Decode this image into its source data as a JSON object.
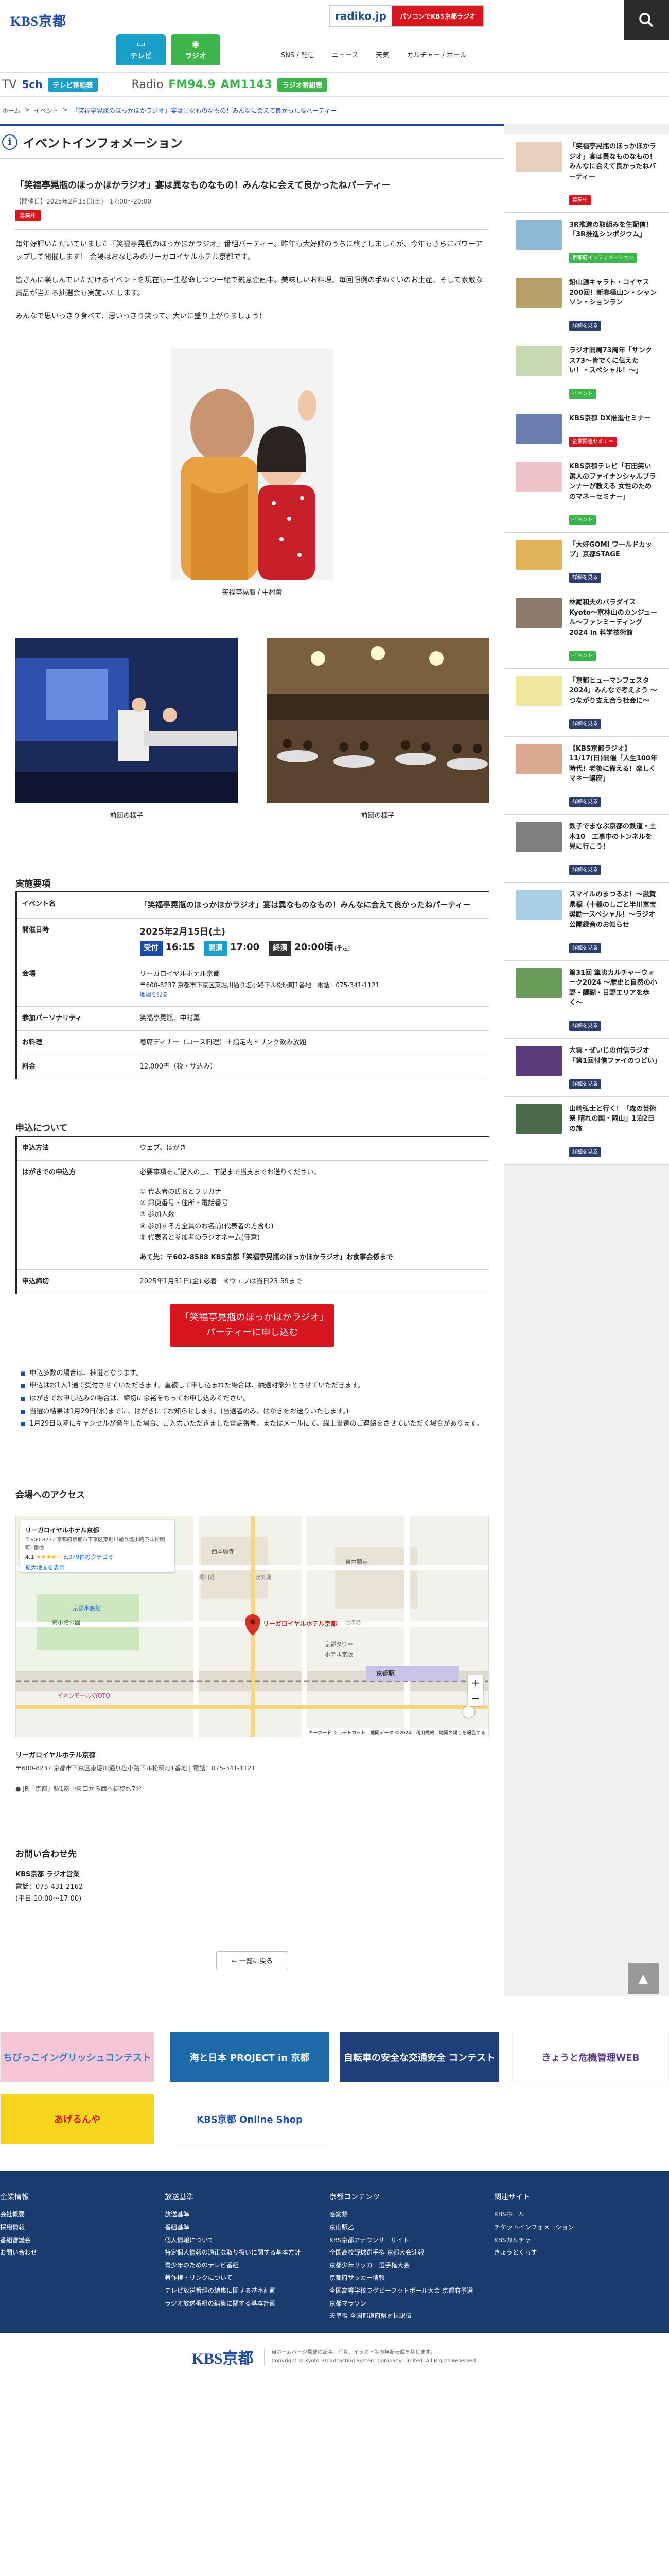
{
  "header": {
    "logo": "KBS京都",
    "tabs": [
      {
        "label": "テレビ",
        "icon": "tv-icon"
      },
      {
        "label": "ラジオ",
        "icon": "radio-icon"
      }
    ],
    "nav": [
      "SNS / 配信",
      "ニュース",
      "天気",
      "カルチャー / ホール"
    ],
    "radiko_logo": "radiko.jp",
    "radiko_text": "パソコンでKBS京都ラジオ"
  },
  "channels": {
    "tv_label": "TV",
    "tv_num": "5ch",
    "tv_pill": "テレビ番組表",
    "radio_label": "Radio",
    "fm": "FM94.9",
    "am": "AM1143",
    "radio_pill": "ラジオ番組表"
  },
  "breadcrumb": {
    "home": "ホーム",
    "events": "イベント",
    "current": "「笑福亭晃瓶のほっかほかラジオ」宴は異なものなもの！みんなに会えて良かったねパーティー"
  },
  "section_title": "イベントインフォメーション",
  "event": {
    "title": "「笑福亭晃瓶のほっかほかラジオ」宴は異なものなもの！みんなに会えて良かったねパーティー",
    "meta": "【開催日】2025年2月15日(土)　17:00〜20:00",
    "tag": "募集中",
    "para1": "毎年好評いただいていました「笑福亭晃瓶のほっかほかラジオ」番組パーティー。昨年も大好評のうちに終了しましたが、今年もさらにパワーアップして開催します！ 会場はおなじみのリーガロイヤルホテル京都です。",
    "para2": "皆さんに楽しんでいただけるイベントを現在も一生懸命しつつ一緒で鋭意企画中。美味しいお料理、毎回恒例の手ぬぐいのお土産、そして素敵な賞品が当たる抽選会も実施いたします。",
    "para3": "みんなで思いっきり食べて、思いっきり笑って、大いに盛り上がりましょう！",
    "photo_caption": "笑福亭晃瓶 / 中村薫",
    "prev1_caption": "前回の様子",
    "prev2_caption": "前回の様子"
  },
  "details": {
    "heading": "実施要項",
    "rows": [
      {
        "key": "イベント名",
        "value": "「笑福亭晃瓶のほっかほかラジオ」宴は異なものなもの！みんなに会えて良かったねパーティー"
      },
      {
        "key": "開催日時",
        "date": "2025年2月15日(土)",
        "open_label": "受付",
        "open_time": "16:15",
        "start_label": "開演",
        "start_time": "17:00",
        "end_label": "終演",
        "end_time": "20:00頃",
        "end_note": "(予定)"
      },
      {
        "key": "会場",
        "value": "リーガロイヤルホテル京都",
        "address": "〒600-8237 京都市下京区東堀川通り塩小路下ル松明町1番地 | 電話：075-341-1121",
        "map_link": "地図を見る"
      },
      {
        "key": "参加パーソナリティ",
        "value": "笑福亭晃瓶、中村薫"
      },
      {
        "key": "お料理",
        "value": "着席ディナー（コース料理）＋指定内ドリンク飲み放題"
      },
      {
        "key": "料金",
        "value": "12,000円（税・サ込み）"
      }
    ]
  },
  "apply": {
    "heading": "申込について",
    "rows": [
      {
        "key": "申込方法",
        "value": "ウェブ、はがき"
      },
      {
        "key": "はがきでの申込方",
        "intro": "必要事項をご記入の上、下記まで当支までお送りください。",
        "items": [
          "① 代表者の氏名とフリガナ",
          "② 郵便番号・住所・電話番号",
          "③ 参加人数",
          "④ 参加する方全員のお名前(代表者の方含む)",
          "⑤ 代表者と参加者のラジオネーム(任意)"
        ],
        "address": "あて先：〒602-8588 KBS京都「笑福亭晃瓶のほっかほかラジオ」お食事会係まで"
      },
      {
        "key": "申込締切",
        "value": "2025年1月31日(金) 必着　※ウェブは当日23:59まで"
      }
    ],
    "button": "「笑福亭晃瓶のほっかほかラジオ」パーティーに申し込む",
    "notes": [
      "申込多数の場合は、抽選となります。",
      "申込はお1人1通で受付させていただきます。重複して申し込まれた場合は、抽選対象外とさせていただきます。",
      "はがきでお申し込みの場合は、締切に余裕をもってお申し込みください。",
      "当選の結果は1月29日(水)までに、はがきにてお知らせします。(当選者のみ。はがきをお送りいたします。)",
      "1月29日以降にキャンセルが発生した場合、ご入力いただきました電話番号、またはメールにて、繰上当選のご連絡をさせていただく場合があります。"
    ]
  },
  "access": {
    "heading": "会場へのアクセス",
    "map_place": "リーガロイヤルホテル京都",
    "map_address": "〒600-8237 京都府京都市下京区東堀川通り塩小路下ル松明町1番地",
    "map_rating": "4.1",
    "map_reviews": "3,079件のクチコミ",
    "map_link": "拡大地図を表示",
    "map_footer": "キーボード ショートカット　地図データ ©2024　利用規約　地図の誤りを報告する",
    "map_labels": [
      "京都水族館",
      "西本願寺",
      "東本願寺",
      "京都駅",
      "梅小路公園",
      "リーガロイヤルホテル京都",
      "イオンモールKYOTO",
      "京都タワー",
      "ホテル京阪",
      "七条通",
      "烏丸通",
      "堀川通"
    ],
    "venue_name": "リーガロイヤルホテル京都",
    "venue_address": "〒600-8237 京都市下京区東堀川通り塩小路下ル松明町1番地 | 電話：075-341-1121",
    "transport": "JR「京都」駅1階中央口から西へ徒歩約7分"
  },
  "contact": {
    "heading": "お問い合わせ先",
    "org": "KBS京都 ラジオ営業",
    "tel": "電話：075-431-2162",
    "hours": "(平日 10:00〜17:00)"
  },
  "back_button": "一覧に戻る",
  "sidebar": [
    {
      "text": "「笑福亭晃瓶のほっかほかラジオ」宴は異なものなもの！みんなに会えて良かったねパーティー",
      "tag": "募集中",
      "tag_color": "#d6151f",
      "thumb": "#e8d0c0"
    },
    {
      "text": "3R推進の取組みを生配信！「3R推進シンポジウム」",
      "tag": "京都府インフォメーション",
      "tag_color": "#3db54a",
      "thumb": "#8fb7d6"
    },
    {
      "text": "鉛山源キャラト・コイヤス 200回！新春極山ン・シャンソン・ションラン",
      "tag": "",
      "tag_color": "",
      "thumb": "#b9a06a"
    },
    {
      "text": "ラジオ開局73周年「サンクス73〜皆でくに伝えたい！・スペシャル！〜」",
      "tag": "イベント",
      "tag_color": "#3db54a",
      "thumb": "#c7d9b2"
    },
    {
      "text": "KBS京都 DX推進セミナー",
      "tag": "企業関連セミナー",
      "tag_color": "#d6151f",
      "thumb": "#6a7fb0"
    },
    {
      "text": "KBS京都テレビ「石田笑い選人のファイナンシャルプランナーが教える 女性のためのマネーセミナー」",
      "tag": "イベント",
      "tag_color": "#3db54a",
      "thumb": "#f0c2c9"
    },
    {
      "text": "「大好GOMI ワールドカップ」京都STAGE",
      "tag": "",
      "tag_color": "",
      "thumb": "#e2b45a"
    },
    {
      "text": "林尾和夫のパラダイスKyoto〜京林山のカンジュール〜ファンミーティング2024 in 科学技術館",
      "tag": "イベント",
      "tag_color": "#3db54a",
      "thumb": "#8d7a6a"
    },
    {
      "text": "「京都ヒューマンフェスタ2024」みんなで考えよう 〜つながり支え合う社会に〜",
      "tag": "",
      "tag_color": "",
      "thumb": "#f1e6a0"
    },
    {
      "text": "【KBS京都ラジオ】11/17(日)開催「人生100年時代！老後に備える！楽しくマネー講座」",
      "tag": "",
      "tag_color": "",
      "thumb": "#d9a88e"
    },
    {
      "text": "鉄子でまなぶ京都の鉄道・土木10　工事中のトンネルを見に行こう！",
      "tag": "",
      "tag_color": "",
      "thumb": "#7f7f7f"
    },
    {
      "text": "スマイルのまつるよ！〜滋賀県稲（十稲のしごと半川富宝奨励ースペシャル！〜ラジオ公開録音のお知らせ",
      "tag": "",
      "tag_color": "",
      "thumb": "#a9cfe6"
    },
    {
      "text": "第31回 筆夷カルチャーウォーク2024 〜歴史と自然の小野・醍醐・日野エリアを歩く〜",
      "tag": "",
      "tag_color": "",
      "thumb": "#6a9c5a"
    },
    {
      "text": "大雲・ぜいじの付信ラジオ「第1回付信ファイのつどい」",
      "tag": "",
      "tag_color": "",
      "thumb": "#5a3a7a"
    },
    {
      "text": "山崎弘士と行く！「森の芸術祭 晴れの国・岡山」1泊2日の旅",
      "tag": "",
      "tag_color": "",
      "thumb": "#4a6a4a"
    }
  ],
  "side_more": "詳細を見る",
  "banners": [
    {
      "label": "ちびっこイングリッシュコンテスト",
      "bg": "#f7c6d6",
      "fg": "#2b7fc2"
    },
    {
      "label": "海と日本 PROJECT in 京都",
      "bg": "#1e6aa8",
      "fg": "#ffffff"
    },
    {
      "label": "自転車の安全な交通安全 コンテスト",
      "bg": "#1e3f7a",
      "fg": "#ffffff"
    },
    {
      "label": "きょうと危機管理WEB",
      "bg": "#ffffff",
      "fg": "#5b3b8a"
    },
    {
      "label": "あげるんや",
      "bg": "#f5d51e",
      "fg": "#d6151f"
    },
    {
      "label": "KBS京都 Online Shop",
      "bg": "#ffffff",
      "fg": "#1e4aa8"
    }
  ],
  "footer": {
    "cols": [
      {
        "title": "企業情報",
        "items": [
          "会社概要",
          "採用情報",
          "番組審議会",
          "お問い合わせ"
        ]
      },
      {
        "title": "放送基準",
        "items": [
          "放送基準",
          "番組基準",
          "個人情報について",
          "特定個人情報の適正な取り扱いに関する基本方針",
          "青少年のためのテレビ番組",
          "著作権・リンクについて",
          "テレビ放送番組の編集に関する基本計画",
          "ラジオ放送番組の編集に関する基本計画"
        ]
      },
      {
        "title": "京都コンテンツ",
        "items": [
          "感謝祭",
          "京山駅乙",
          "KBS京都アナウンサーサイト",
          "全国高校野球選手権 京都大会速報",
          "京都少年サッカー選手権大会",
          "京都府サッカー情報",
          "全国高等学校ラグビーフットボール大会 京都府予選",
          "京都マラソン",
          "天皇盃 全国都道府県対抗駅伝"
        ]
      },
      {
        "title": "関連サイト",
        "items": [
          "KBSホール",
          "チケットインフォメーション",
          "KBSカルチャー",
          "きょうとくらす"
        ]
      }
    ],
    "logo": "KBS京都",
    "copy1": "当ホームページ掲載の記事、写真、イラスト等の無断転載を禁じます。",
    "copy2": "Copyright © Kyoto Broadcasting System Company Limited. All Rights Reserved."
  }
}
